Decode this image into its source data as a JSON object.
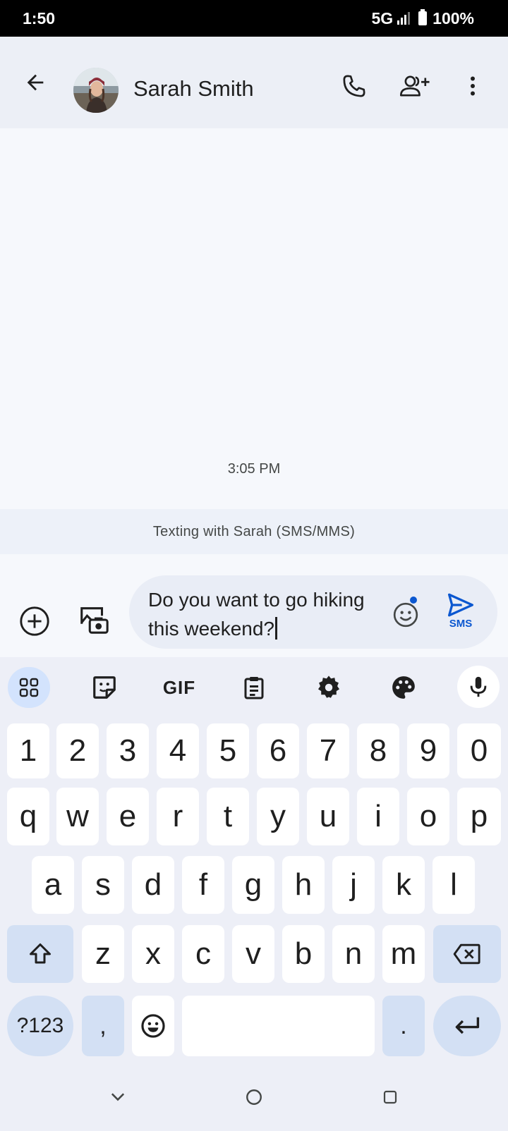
{
  "status_bar": {
    "time": "1:50",
    "network": "5G",
    "battery": "100%"
  },
  "header": {
    "contact_name": "Sarah Smith",
    "icons": [
      "back-arrow-icon",
      "avatar",
      "phone-icon",
      "add-person-icon",
      "more-vert-icon"
    ]
  },
  "conversation": {
    "timestamp": "3:05 PM",
    "banner": "Texting with Sarah (SMS/MMS)"
  },
  "compose": {
    "text": "Do you want to go hiking this weekend?",
    "send_label": "SMS",
    "accent_color": "#0b57d0"
  },
  "keyboard": {
    "number_row": [
      "1",
      "2",
      "3",
      "4",
      "5",
      "6",
      "7",
      "8",
      "9",
      "0"
    ],
    "row1": [
      "q",
      "w",
      "e",
      "r",
      "t",
      "y",
      "u",
      "i",
      "o",
      "p"
    ],
    "row2": [
      "a",
      "s",
      "d",
      "f",
      "g",
      "h",
      "j",
      "k",
      "l"
    ],
    "row3": [
      "z",
      "x",
      "c",
      "v",
      "b",
      "n",
      "m"
    ],
    "symbols_label": "?123",
    "comma": ",",
    "period": ".",
    "toolbar_gif": "GIF"
  }
}
